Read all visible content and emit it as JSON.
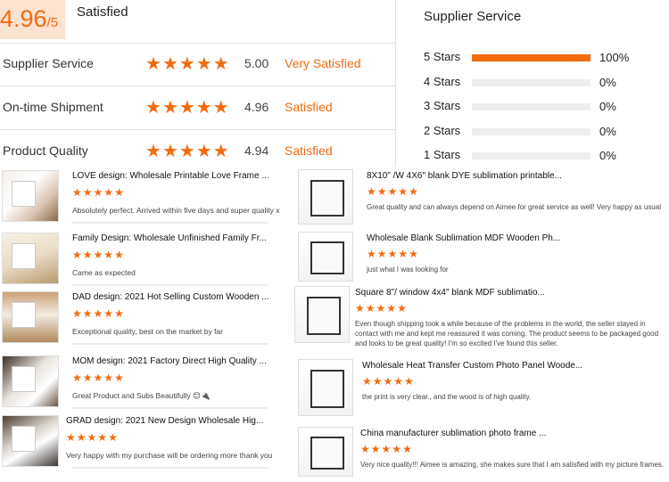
{
  "summary": {
    "score": "4.96",
    "score_max": "/5",
    "label": "Satisfied"
  },
  "metrics": [
    {
      "label": "Supplier Service",
      "value": "5.00",
      "word": "Very Satisfied"
    },
    {
      "label": "On-time Shipment",
      "value": "4.96",
      "word": "Satisfied"
    },
    {
      "label": "Product Quality",
      "value": "4.94",
      "word": "Satisfied"
    }
  ],
  "distribution": {
    "title": "Supplier Service",
    "rows": [
      {
        "label": "5 Stars",
        "pct": "100%",
        "fraction": 1.0
      },
      {
        "label": "4 Stars",
        "pct": "0%",
        "fraction": 0.0
      },
      {
        "label": "3 Stars",
        "pct": "0%",
        "fraction": 0.0
      },
      {
        "label": "2 Stars",
        "pct": "0%",
        "fraction": 0.0
      },
      {
        "label": "1 Stars",
        "pct": "0%",
        "fraction": 0.0
      }
    ]
  },
  "reviews_left": [
    {
      "title": "LOVE design: Wholesale Printable Love Frame ...",
      "text": "Absolutely perfect. Arrived within five days and super quality x",
      "rating": 5
    },
    {
      "title": "Family Design: Wholesale Unfinished Family Fr...",
      "text": "Came as expected",
      "rating": 5
    },
    {
      "title": "DAD design: 2021 Hot Selling Custom Wooden ...",
      "text": "Exceptional quality, best on the market by far",
      "rating": 5
    },
    {
      "title": "MOM design: 2021 Factory Direct High Quality ...",
      "text": "Great Product and Subs Beautifully 😊🔌",
      "rating": 5
    },
    {
      "title": "GRAD design: 2021 New Design Wholesale Hig...",
      "text": "Very happy with my purchase will be ordering more thank you",
      "rating": 5
    }
  ],
  "reviews_right": [
    {
      "title": "8X10\" /W 4X6\" blank DYE sublimation printable...",
      "text": "Great quality and can always depend on Aimee for great service as well!  Very happy as usual",
      "rating": 5
    },
    {
      "title": "Wholesale Blank Sublimation MDF Wooden Ph...",
      "text": "just what I was looking for",
      "rating": 5
    },
    {
      "title": "Square 8\"/ window 4x4\" blank MDF sublimatio...",
      "text": "Even though shipping took a while because of the problems in the world, the seller stayed in contact with me and kept me reassured it was coming. The product seems to be packaged good and looks to be great quality! I'm so excited I've found this seller.",
      "rating": 5
    },
    {
      "title": "Wholesale Heat Transfer Custom Photo Panel Woode...",
      "text": "the print is very clear., and the wood is of high quality.",
      "rating": 5
    },
    {
      "title": "China manufacturer sublimation photo frame ...",
      "text": "Very nice quality!!! Aimee is amazing, she makes sure that I am satisfied with my picture frames.",
      "rating": 5
    }
  ],
  "icons": {
    "star": "star-icon"
  },
  "colors": {
    "accent": "#f26b0f",
    "score_bg": "#fde3d2"
  }
}
